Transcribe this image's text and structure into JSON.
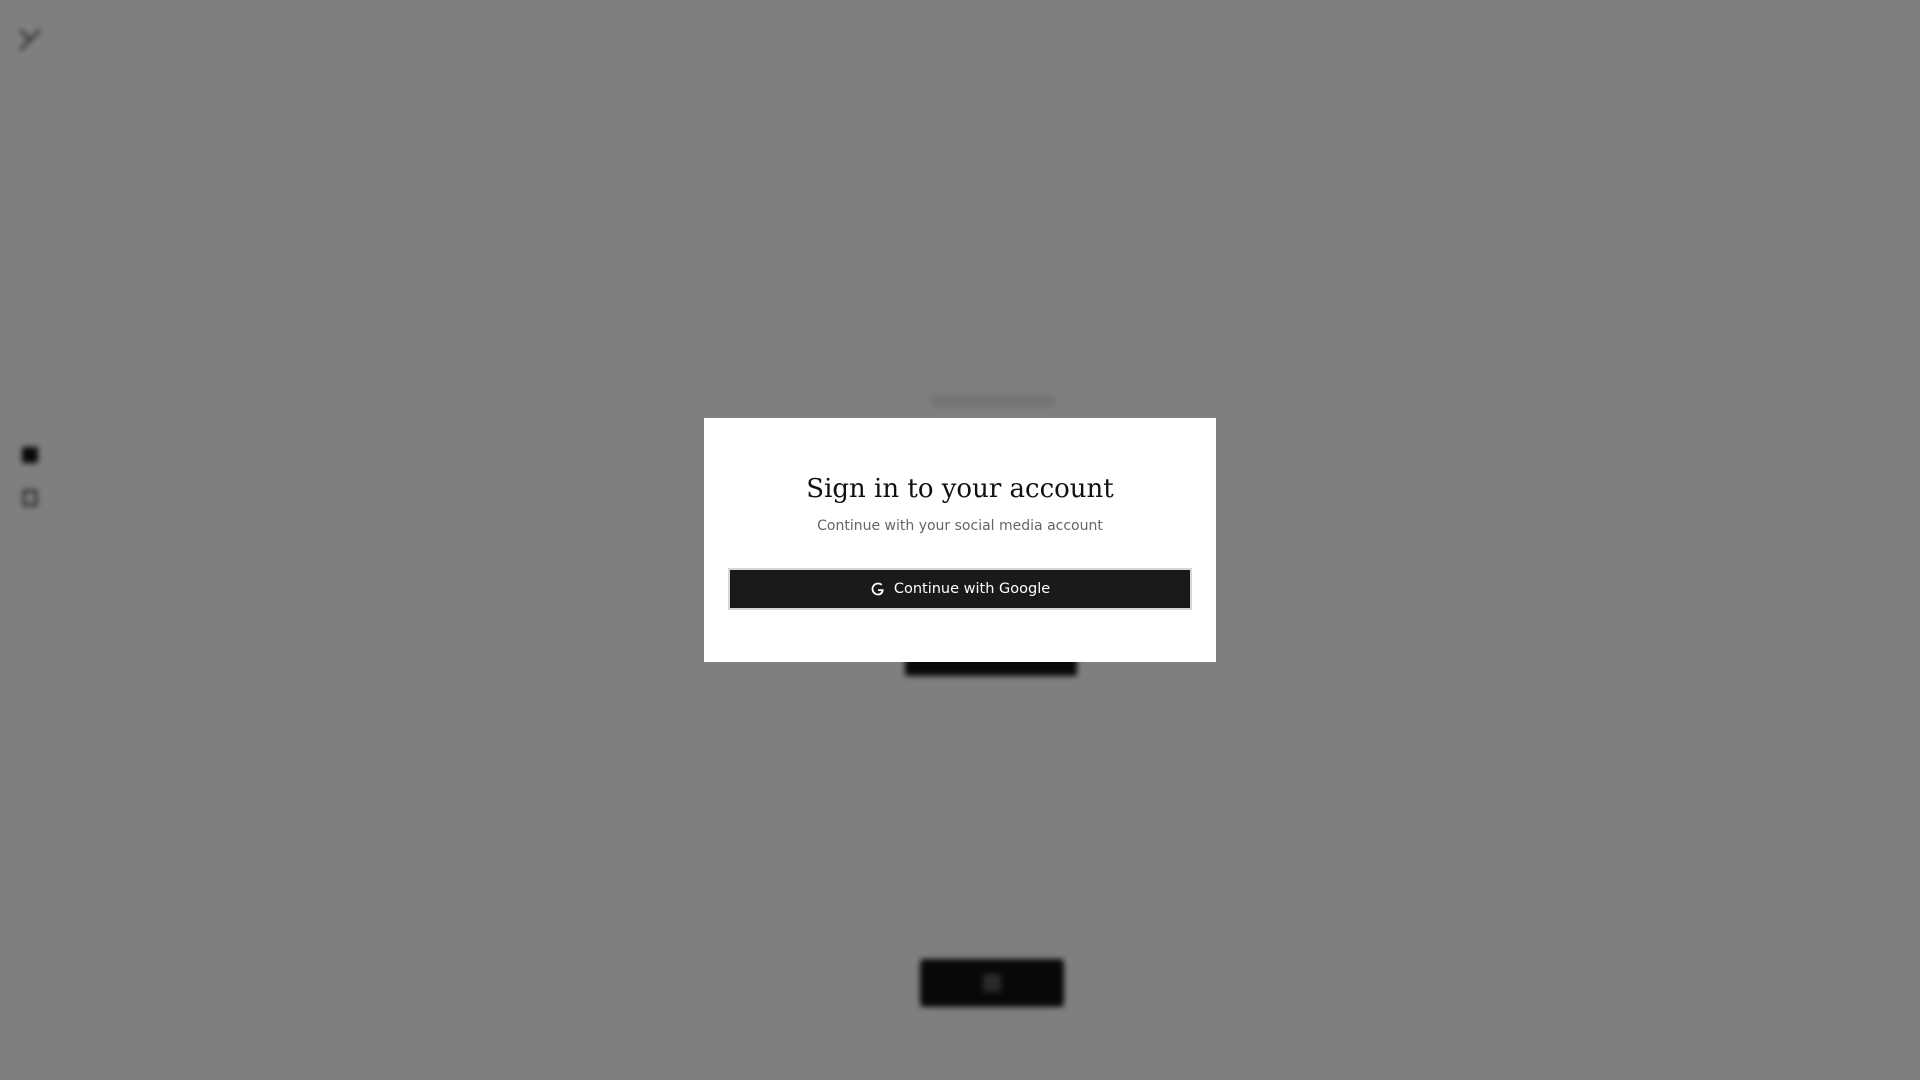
{
  "modal": {
    "title": "Sign in to your account",
    "subtitle": "Continue with your social media account",
    "google_button_label": "Continue with Google"
  },
  "icons": {
    "logo": "logo-icon",
    "google": "google-icon",
    "sidebar": [
      "grid-icon",
      "book-icon"
    ]
  },
  "colors": {
    "overlay": "#808080",
    "button_bg": "#1a1a1a",
    "modal_bg": "#ffffff"
  }
}
